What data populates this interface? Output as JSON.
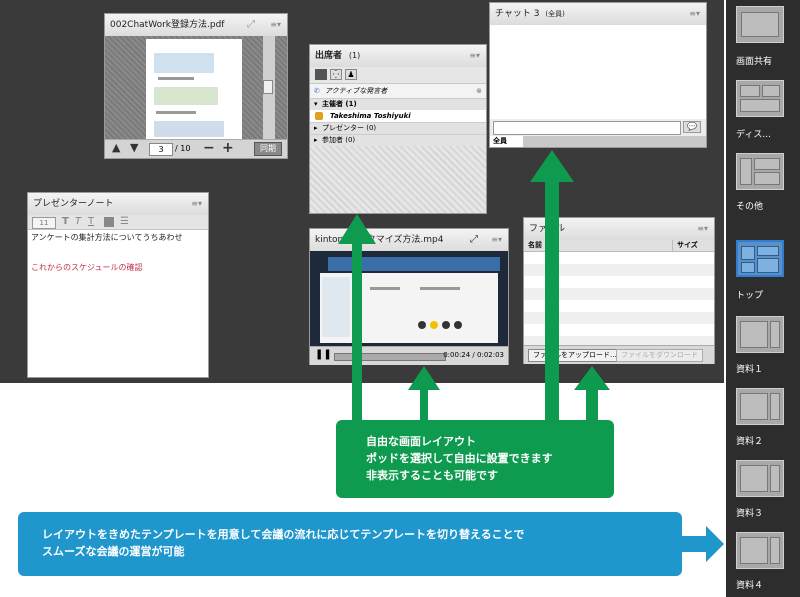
{
  "pods": {
    "pdf": {
      "title": "002ChatWork登録方法.pdf",
      "page_value": "3",
      "page_total": "/ 10",
      "sync_label": "同期"
    },
    "attendees": {
      "title": "出席者",
      "count": "(1)",
      "active_speaker": "アクティブな発言者",
      "host_group": "主催者 (1)",
      "host_name": "Takeshima Toshiyuki",
      "presenter_group": "プレゼンター (0)",
      "participant_group": "参加者 (0)"
    },
    "chat": {
      "title": "チャット 3",
      "title_tag": "(全員)",
      "recipient": "全員"
    },
    "notes": {
      "title": "プレゼンターノート",
      "font_size": "11",
      "line1": "アンケートの集計方法についてうちあわせ",
      "line2": "これからのスケジュールの確認"
    },
    "video": {
      "title": "kintoneカスタマイズ方法.mp4",
      "time": "0:00:24 / 0:02:03"
    },
    "files": {
      "title": "ファイル",
      "col_name": "名前",
      "col_size": "サイズ",
      "upload_label": "ファイルをアップロード...",
      "download_label": "ファイルをダウンロード"
    }
  },
  "sidebar": {
    "items": [
      {
        "label": "画面共有"
      },
      {
        "label": "ディス..."
      },
      {
        "label": "その他"
      },
      {
        "label": "トップ"
      },
      {
        "label": "資料１"
      },
      {
        "label": "資料２"
      },
      {
        "label": "資料３"
      },
      {
        "label": "資料４"
      }
    ]
  },
  "callouts": {
    "green": {
      "line1": "自由な画面レイアウト",
      "line2": "ポッドを選択して自由に設置できます",
      "line3": "非表示することも可能です"
    },
    "blue": {
      "line1": "レイアウトをきめたテンプレートを用意して会議の流れに応じてテンプレートを切り替えることで",
      "line2": "スムーズな会議の運営が可能"
    }
  },
  "colors": {
    "stage": "#3a3a3a",
    "green": "#0e9a4f",
    "blue": "#1f96cc",
    "active": "#2e7fd1",
    "note_red": "#c0304a"
  }
}
